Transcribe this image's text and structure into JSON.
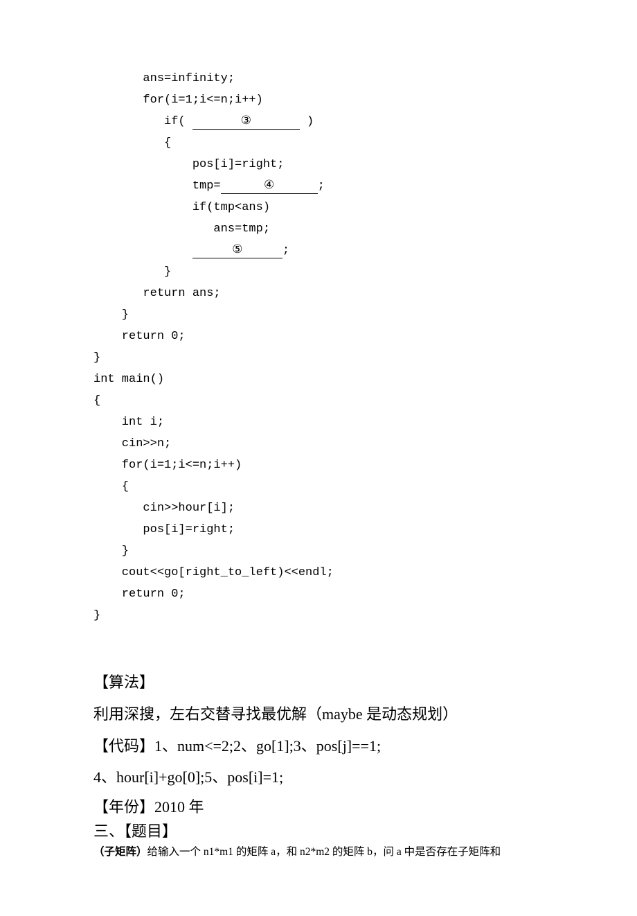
{
  "code": {
    "line1": "       ans=infinity;",
    "line2": "       for(i=1;i<=n;i++)",
    "line3a": "          if( ",
    "blank3": "③",
    "line3b": " )",
    "line4": "          {",
    "line5": "              pos[i]=right;",
    "line6a": "              tmp=",
    "blank4": "④",
    "line6b": ";",
    "line7": "              if(tmp<ans)",
    "line8": "                 ans=tmp;",
    "line9a": "              ",
    "blank5": "⑤",
    "line9b": ";",
    "line10": "          }",
    "line11": "       return ans;",
    "line12": "    }",
    "line13": "    return 0;",
    "line14": "}",
    "line15": "int main()",
    "line16": "{",
    "line17": "    int i;",
    "line18": "    cin>>n;",
    "line19": "    for(i=1;i<=n;i++)",
    "line20": "    {",
    "line21": "       cin>>hour[i];",
    "line22": "       pos[i]=right;",
    "line23": "    }",
    "line24": "    cout<<go[right_to_left)<<endl;",
    "line25": "    return 0;",
    "line26": "}"
  },
  "sections": {
    "algo_heading": "【算法】",
    "algo_body": "利用深搜，左右交替寻找最优解（maybe 是动态规划）",
    "code_ans1": "【代码】1、num<=2;2、go[1];3、pos[j]==1;",
    "code_ans2": "4、hour[i]+go[0];5、pos[i]=1;",
    "year": "【年份】2010 年",
    "problem_num": "三、【题目】",
    "problem_title_bold": "（子矩阵）",
    "problem_body": "给输入一个 n1*m1 的矩阵 a，和 n2*m2 的矩阵 b，问 a 中是否存在子矩阵和"
  }
}
